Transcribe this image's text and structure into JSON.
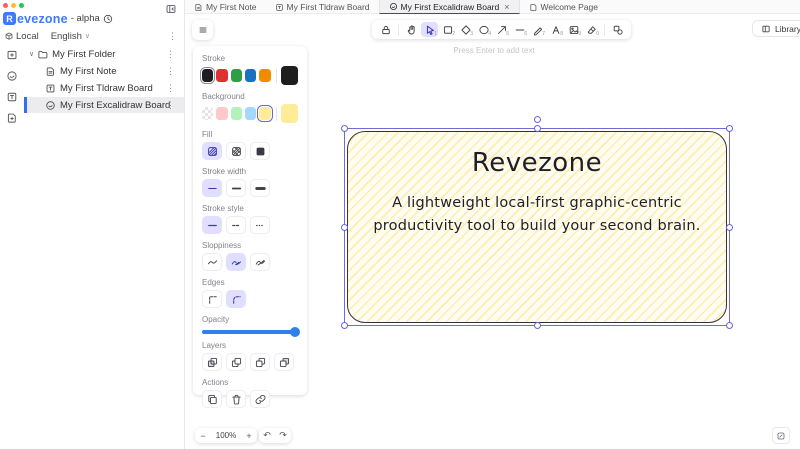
{
  "window": {
    "brand_letter": "R",
    "brand": "evezone",
    "suffix": "- alpha",
    "workspace": "Local",
    "language": "English"
  },
  "sidebar": {
    "folder": "My First Folder",
    "items": [
      {
        "label": "My First Note"
      },
      {
        "label": "My First Tldraw Board"
      },
      {
        "label": "My First Excalidraw Board"
      }
    ]
  },
  "tabs": [
    {
      "label": "My First Note"
    },
    {
      "label": "My First Tldraw Board"
    },
    {
      "label": "My First Excalidraw Board"
    },
    {
      "label": "Welcome Page"
    }
  ],
  "toolbar": {
    "tools": [
      {
        "name": "lock"
      },
      {
        "name": "hand"
      },
      {
        "name": "selection",
        "shortcut": "1",
        "active": true
      },
      {
        "name": "rectangle",
        "shortcut": "2"
      },
      {
        "name": "diamond",
        "shortcut": "3"
      },
      {
        "name": "ellipse",
        "shortcut": "4"
      },
      {
        "name": "arrow",
        "shortcut": "5"
      },
      {
        "name": "line",
        "shortcut": "6"
      },
      {
        "name": "draw",
        "shortcut": "7"
      },
      {
        "name": "text",
        "shortcut": "8"
      },
      {
        "name": "image",
        "shortcut": "9"
      },
      {
        "name": "eraser",
        "shortcut": "0"
      },
      {
        "name": "more-shapes"
      }
    ],
    "library": "Library",
    "hint": "Press Enter to add text"
  },
  "panel": {
    "stroke": {
      "label": "Stroke",
      "colors": [
        "#1e1e1e",
        "#e03131",
        "#2f9e44",
        "#1971c2",
        "#f08c00"
      ],
      "current": "#1e1e1e"
    },
    "background": {
      "label": "Background",
      "colors": [
        "transparent",
        "#ffc9c9",
        "#b2f2bb",
        "#a5d8ff",
        "#ffec99"
      ],
      "current": "#ffec99"
    },
    "fill": {
      "label": "Fill"
    },
    "stroke_width": {
      "label": "Stroke width"
    },
    "stroke_style": {
      "label": "Stroke style"
    },
    "sloppiness": {
      "label": "Sloppiness"
    },
    "edges": {
      "label": "Edges"
    },
    "opacity": {
      "label": "Opacity",
      "value": 100
    },
    "layers": {
      "label": "Layers"
    },
    "actions": {
      "label": "Actions"
    }
  },
  "canvas": {
    "card": {
      "title": "Revezone",
      "body": "A lightweight local-first graphic-centric productivity tool to build your second brain."
    }
  },
  "footer": {
    "zoom": "100%"
  },
  "icons": {
    "minus": "−",
    "plus": "+",
    "undo": "↶",
    "redo": "↷",
    "close": "×",
    "kebab": "⋮",
    "chevron_down": "∨"
  },
  "colors": {
    "accent_blue": "#2d70f6",
    "logo_blue": "#3e7bfa",
    "selection_purple": "#6965db",
    "selected_button_bg": "#e0dfff",
    "slider_blue": "#2f80ed",
    "traffic": [
      "#ff5f57",
      "#febc2e",
      "#28c840"
    ]
  }
}
